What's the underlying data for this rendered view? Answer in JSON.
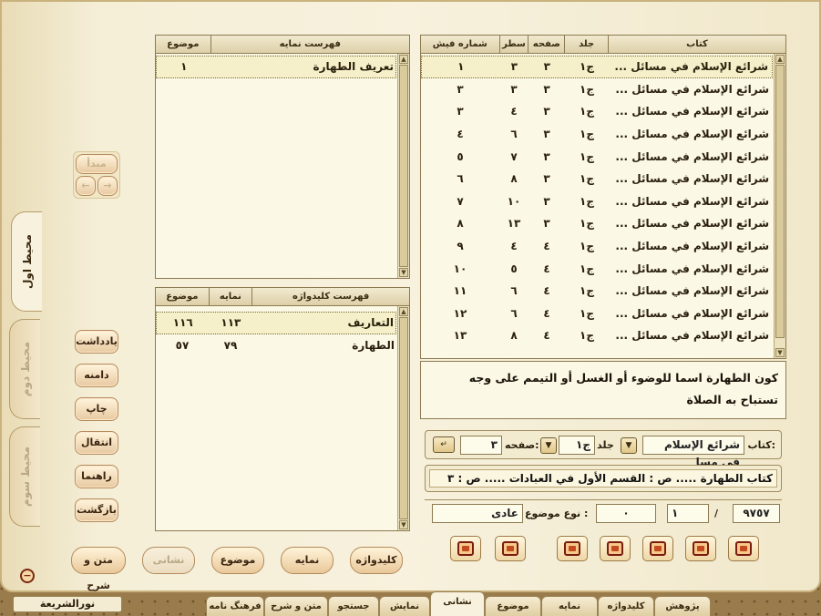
{
  "right_table": {
    "columns": [
      "کتاب",
      "جلد",
      "صفحه",
      "سطر",
      "شماره فیش"
    ],
    "rows": [
      {
        "book": "شرائع الإسلام في مسائل ...",
        "vol": "ج١",
        "page": "٣",
        "line": "٣",
        "num": "١"
      },
      {
        "book": "شرائع الإسلام في مسائل ...",
        "vol": "ج١",
        "page": "٣",
        "line": "٣",
        "num": "٣"
      },
      {
        "book": "شرائع الإسلام في مسائل ...",
        "vol": "ج١",
        "page": "٣",
        "line": "٤",
        "num": "٣"
      },
      {
        "book": "شرائع الإسلام في مسائل ...",
        "vol": "ج١",
        "page": "٣",
        "line": "٦",
        "num": "٤"
      },
      {
        "book": "شرائع الإسلام في مسائل ...",
        "vol": "ج١",
        "page": "٣",
        "line": "٧",
        "num": "٥"
      },
      {
        "book": "شرائع الإسلام في مسائل ...",
        "vol": "ج١",
        "page": "٣",
        "line": "٨",
        "num": "٦"
      },
      {
        "book": "شرائع الإسلام في مسائل ...",
        "vol": "ج١",
        "page": "٣",
        "line": "١٠",
        "num": "٧"
      },
      {
        "book": "شرائع الإسلام في مسائل ...",
        "vol": "ج١",
        "page": "٣",
        "line": "١٣",
        "num": "٨"
      },
      {
        "book": "شرائع الإسلام في مسائل ...",
        "vol": "ج١",
        "page": "٤",
        "line": "٤",
        "num": "٩"
      },
      {
        "book": "شرائع الإسلام في مسائل ...",
        "vol": "ج١",
        "page": "٤",
        "line": "٥",
        "num": "١٠"
      },
      {
        "book": "شرائع الإسلام في مسائل ...",
        "vol": "ج١",
        "page": "٤",
        "line": "٦",
        "num": "١١"
      },
      {
        "book": "شرائع الإسلام في مسائل ...",
        "vol": "ج١",
        "page": "٤",
        "line": "٦",
        "num": "١٢"
      },
      {
        "book": "شرائع الإسلام في مسائل ...",
        "vol": "ج١",
        "page": "٤",
        "line": "٨",
        "num": "١٣"
      }
    ]
  },
  "index_table": {
    "columns": [
      "فهرست نمایه",
      "موضوع"
    ],
    "rows": [
      {
        "title": "تعريف الطهارة",
        "topic": "١"
      }
    ]
  },
  "keyword_table": {
    "columns": [
      "فهرست کلیدواژه",
      "نمایه",
      "موضوع"
    ],
    "rows": [
      {
        "title": "التعاريف",
        "index": "١١٣",
        "topic": "١١٦"
      },
      {
        "title": "الطهارة",
        "index": "٧٩",
        "topic": "٥٧"
      }
    ]
  },
  "text_box": "كون الطهارة اسما للوضوء أو الغسل أو التيمم على وجه تستباح به الصلاة",
  "nav_row": {
    "book_label": "کتاب:",
    "book_value": "شرائع الإسلام في مسا",
    "vol_label": "جلد",
    "vol_value": "ج١",
    "page_label": "صفحه:",
    "page_value": "٣"
  },
  "breadcrumb": "كتاب الطهارة ..... ص :   القسم الأول في العبادات ..... ص : ٣",
  "counter_row": {
    "total": "٩٧٥٧",
    "sep": "/",
    "current": "١",
    "zero": "٠",
    "type_label": "نوع موضوع :",
    "type_value": "عادی"
  },
  "left_nav": {
    "start": "مبدأ",
    "prev": "←",
    "next": "→"
  },
  "side_buttons": [
    "یادداشت",
    "دامنه",
    "چاپ",
    "انتقال",
    "راهنما",
    "بازگشت"
  ],
  "bottom_buttons": [
    "کلیدواژه",
    "نمایه",
    "موضوع",
    "نشانی",
    "متن و شرح"
  ],
  "vertical_tabs": [
    "محیط اول",
    "محیط دوم",
    "محیط سوم"
  ],
  "bottom_tabs": [
    "پژوهش",
    "کلیدواژه",
    "نمایه",
    "موضوع",
    "نشانی",
    "نمایش",
    "جستجو",
    "متن و شرح",
    "فرهنگ نامه"
  ],
  "app_name": "نورالشریعة",
  "minimize": "−"
}
